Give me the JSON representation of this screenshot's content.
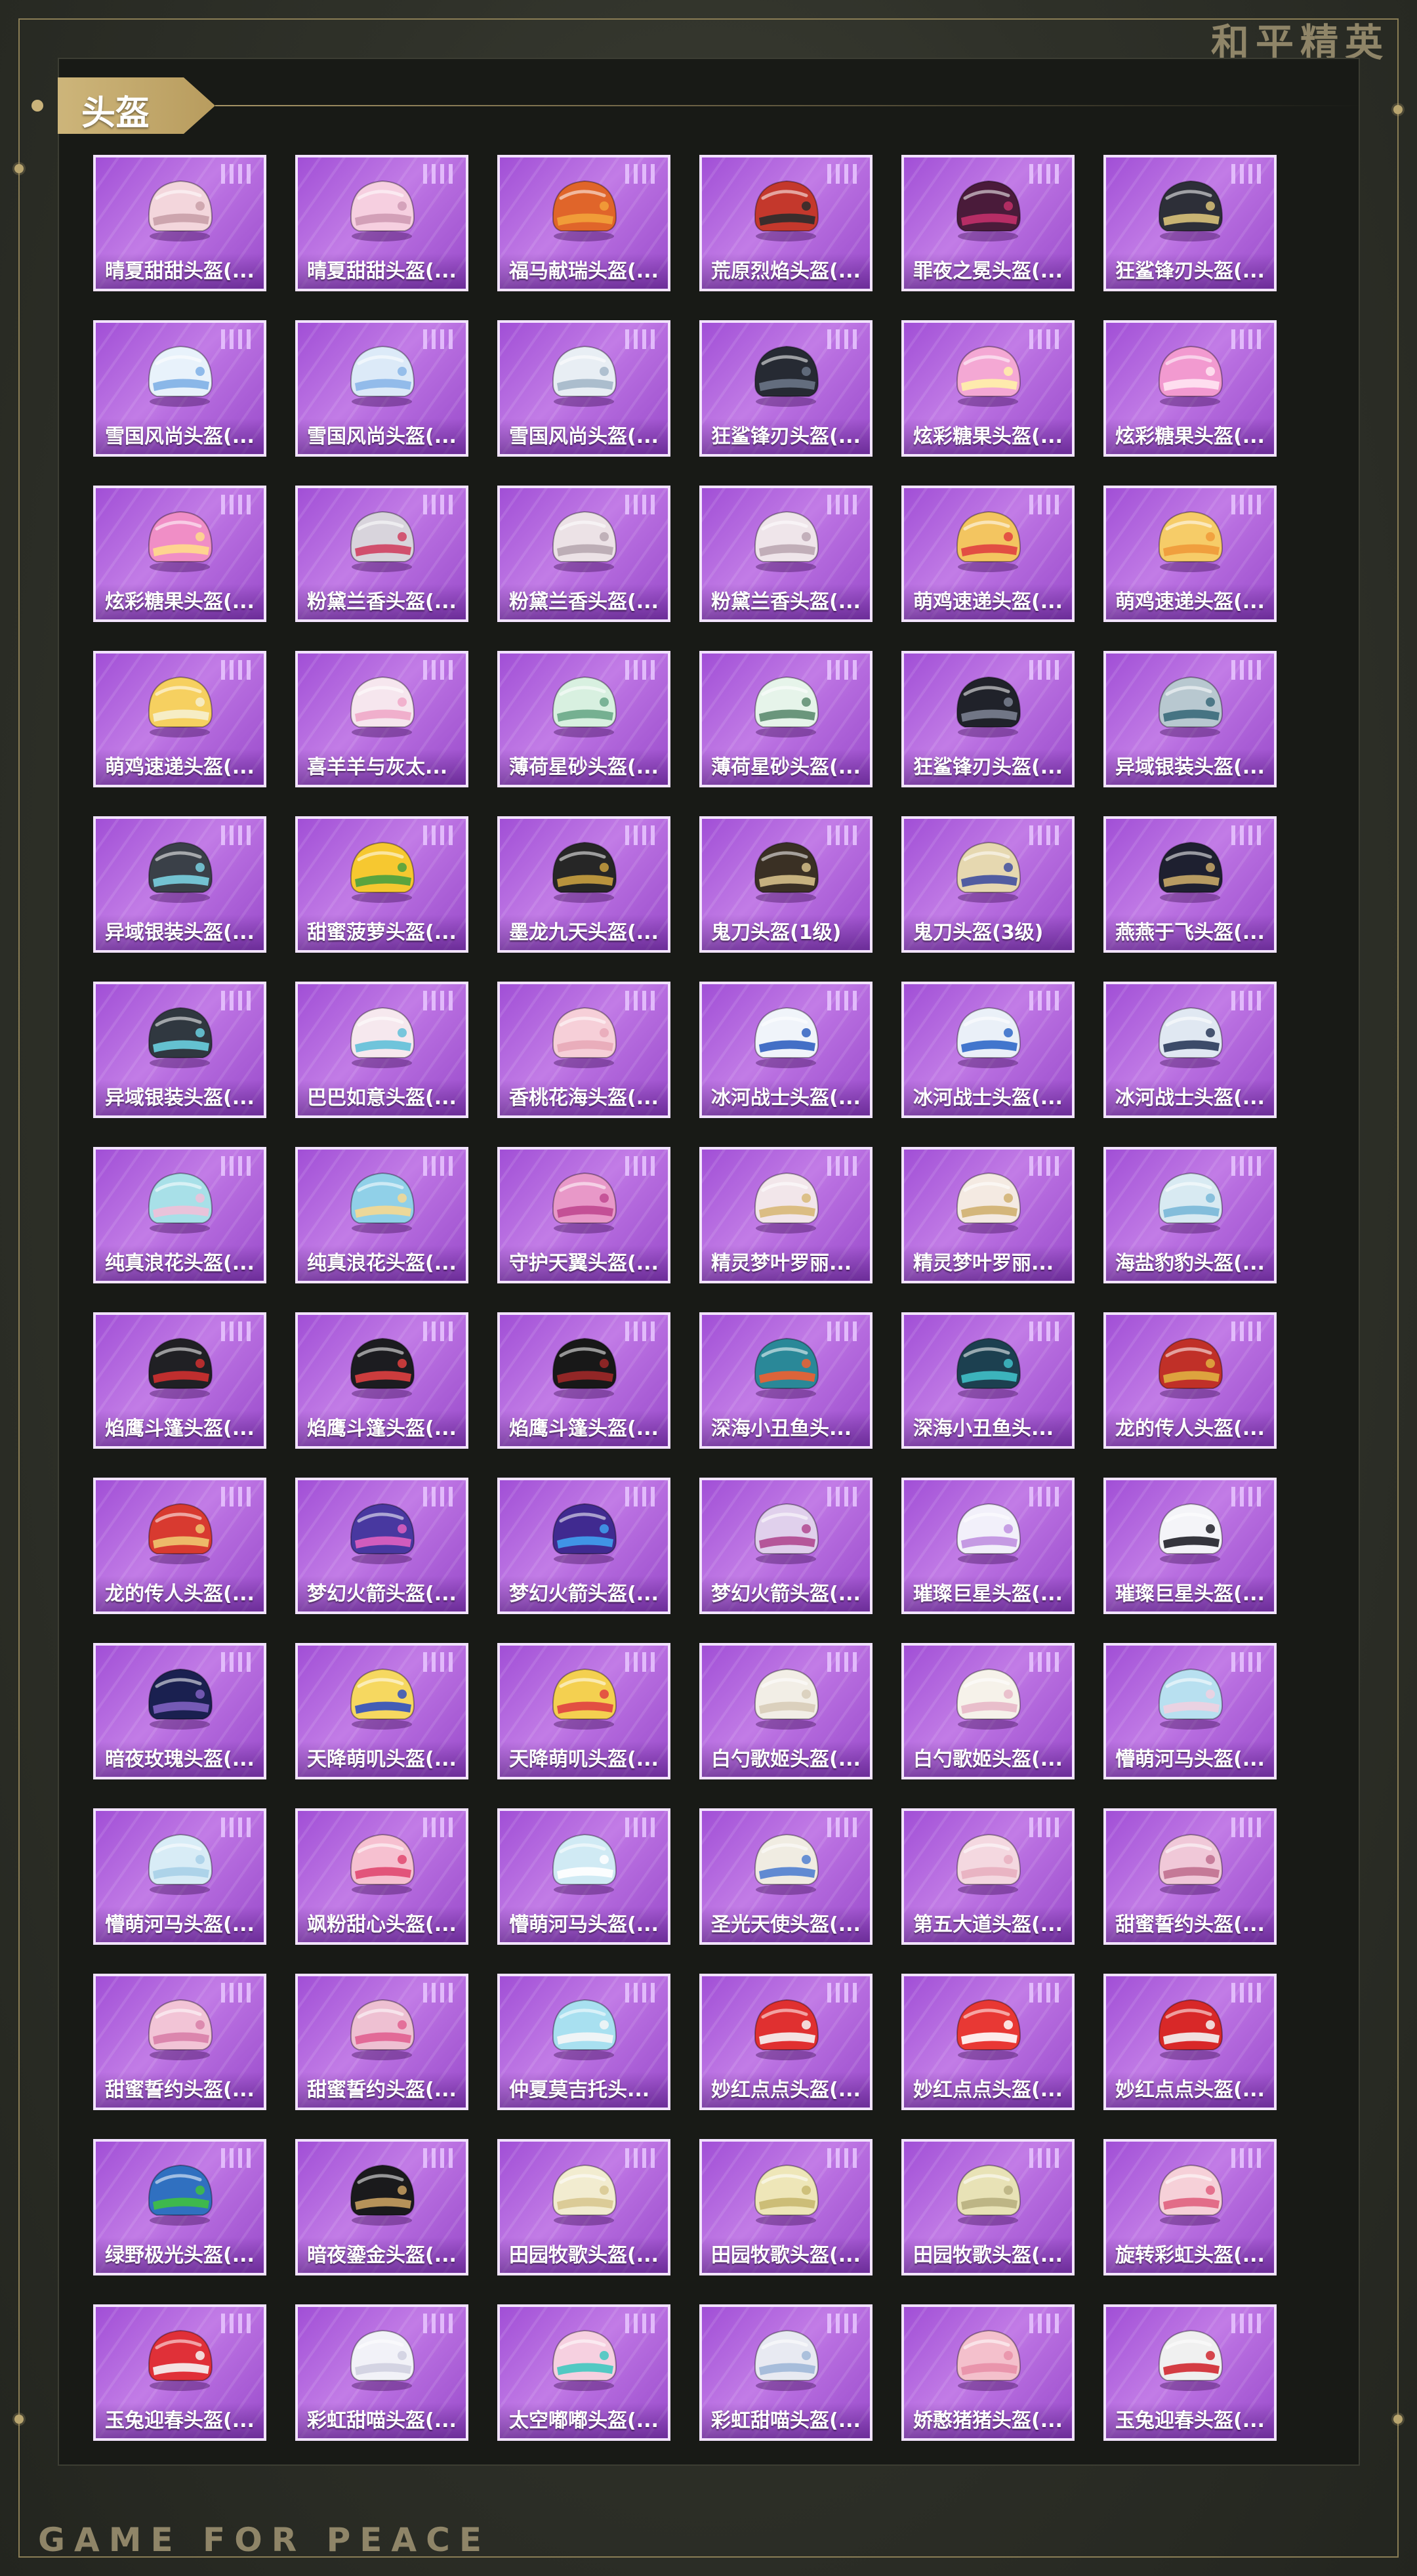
{
  "brand": "和平精英",
  "section": "头盔",
  "footer": "GAME FOR PEACE",
  "colors": {
    "card": "#b86ee0",
    "gold": "#cdb57a",
    "panel": "#181a16"
  },
  "items": [
    {
      "name": "晴夏甜甜头盔(...",
      "color": "#f3d6dc",
      "accent": "#c9a0a8"
    },
    {
      "name": "晴夏甜甜头盔(...",
      "color": "#f6cfe0",
      "accent": "#cf9ab4"
    },
    {
      "name": "福马献瑞头盔(...",
      "color": "#e0652a",
      "accent": "#f2a23a"
    },
    {
      "name": "荒原烈焰头盔(...",
      "color": "#c4382c",
      "accent": "#2c2c2c"
    },
    {
      "name": "罪夜之冕头盔(...",
      "color": "#4a1b3a",
      "accent": "#c2306a"
    },
    {
      "name": "狂鲨锋刃头盔(...",
      "color": "#2d2f38",
      "accent": "#d9c27a"
    },
    {
      "name": "雪国风尚头盔(...",
      "color": "#e8f2fb",
      "accent": "#7fb0e6"
    },
    {
      "name": "雪国风尚头盔(...",
      "color": "#dceaf8",
      "accent": "#8ab6e8"
    },
    {
      "name": "雪国风尚头盔(...",
      "color": "#e8eef4",
      "accent": "#a4b7c9"
    },
    {
      "name": "狂鲨锋刃头盔(...",
      "color": "#262a33",
      "accent": "#6a7486"
    },
    {
      "name": "炫彩糖果头盔(...",
      "color": "#f4a8d4",
      "accent": "#fff1a8"
    },
    {
      "name": "炫彩糖果头盔(...",
      "color": "#f29ad0",
      "accent": "#ffe6f2"
    },
    {
      "name": "炫彩糖果头盔(...",
      "color": "#f08ec6",
      "accent": "#ffdc8a"
    },
    {
      "name": "粉黛兰香头盔(...",
      "color": "#d8d4dc",
      "accent": "#d04060"
    },
    {
      "name": "粉黛兰香头盔(...",
      "color": "#ece2e6",
      "accent": "#b8a8b0"
    },
    {
      "name": "粉黛兰香头盔(...",
      "color": "#efe5ea",
      "accent": "#bba7b3"
    },
    {
      "name": "萌鸡速递头盔(...",
      "color": "#f3c560",
      "accent": "#e04040"
    },
    {
      "name": "萌鸡速递头盔(...",
      "color": "#f6cc68",
      "accent": "#f09a3a"
    },
    {
      "name": "萌鸡速递头盔(...",
      "color": "#f6d060",
      "accent": "#f6f0d0"
    },
    {
      "name": "喜羊羊与灰太...",
      "color": "#f6e6ee",
      "accent": "#f0a8c8"
    },
    {
      "name": "薄荷星砂头盔(...",
      "color": "#d8f0e0",
      "accent": "#6aa888"
    },
    {
      "name": "薄荷星砂头盔(...",
      "color": "#e6f4ea",
      "accent": "#5c8c70"
    },
    {
      "name": "狂鲨锋刃头盔(...",
      "color": "#20222a",
      "accent": "#7a8090"
    },
    {
      "name": "异域银装头盔(...",
      "color": "#b8c8d0",
      "accent": "#3a6a7a"
    },
    {
      "name": "异域银装头盔(...",
      "color": "#3a4048",
      "accent": "#7ad0e0"
    },
    {
      "name": "甜蜜菠萝头盔(...",
      "color": "#f6c830",
      "accent": "#4aa040"
    },
    {
      "name": "墨龙九天头盔(...",
      "color": "#262626",
      "accent": "#c9a040"
    },
    {
      "name": "鬼刀头盔(1级)",
      "color": "#3a3024",
      "accent": "#d6c08a"
    },
    {
      "name": "鬼刀头盔(3级)",
      "color": "#e6d8b0",
      "accent": "#4050a0"
    },
    {
      "name": "燕燕于飞头盔(...",
      "color": "#1e2030",
      "accent": "#c8a868"
    },
    {
      "name": "异域银装头盔(...",
      "color": "#303840",
      "accent": "#6ad0e0"
    },
    {
      "name": "巴巴如意头盔(...",
      "color": "#f6e8ee",
      "accent": "#60c0d8"
    },
    {
      "name": "香桃花海头盔(...",
      "color": "#f6cfd8",
      "accent": "#e8a8b8"
    },
    {
      "name": "冰河战士头盔(...",
      "color": "#f0f4fa",
      "accent": "#3060c0"
    },
    {
      "name": "冰河战士头盔(...",
      "color": "#eaf0f8",
      "accent": "#3068c8"
    },
    {
      "name": "冰河战士头盔(...",
      "color": "#e0e8f2",
      "accent": "#2a3a5a"
    },
    {
      "name": "纯真浪花头盔(...",
      "color": "#a8e0e8",
      "accent": "#f0c0d8"
    },
    {
      "name": "纯真浪花头盔(...",
      "color": "#90d0e8",
      "accent": "#f6d890"
    },
    {
      "name": "守护天翼头盔(...",
      "color": "#e898c8",
      "accent": "#c04890"
    },
    {
      "name": "精灵梦叶罗丽...",
      "color": "#f2e6ea",
      "accent": "#d8b878"
    },
    {
      "name": "精灵梦叶罗丽...",
      "color": "#f4eae2",
      "accent": "#d0b070"
    },
    {
      "name": "海盐豹豹头盔(...",
      "color": "#d8eaf2",
      "accent": "#7ab8d8"
    },
    {
      "name": "焰鹰斗篷头盔(...",
      "color": "#202024",
      "accent": "#d03030"
    },
    {
      "name": "焰鹰斗篷头盔(...",
      "color": "#1c1c20",
      "accent": "#e04040"
    },
    {
      "name": "焰鹰斗篷头盔(...",
      "color": "#181818",
      "accent": "#a02828"
    },
    {
      "name": "深海小丑鱼头...",
      "color": "#2a8898",
      "accent": "#f06030"
    },
    {
      "name": "深海小丑鱼头...",
      "color": "#1c4050",
      "accent": "#40c0c8"
    },
    {
      "name": "龙的传人头盔(...",
      "color": "#c03028",
      "accent": "#e0b040"
    },
    {
      "name": "龙的传人头盔(...",
      "color": "#d83a30",
      "accent": "#f0c870"
    },
    {
      "name": "梦幻火箭头盔(...",
      "color": "#4838a0",
      "accent": "#e060c0"
    },
    {
      "name": "梦幻火箭头盔(...",
      "color": "#402a90",
      "accent": "#40a0f0"
    },
    {
      "name": "梦幻火箭头盔(...",
      "color": "#e0d0ec",
      "accent": "#b04890"
    },
    {
      "name": "璀璨巨星头盔(...",
      "color": "#f2f0fa",
      "accent": "#c090e0"
    },
    {
      "name": "璀璨巨星头盔(...",
      "color": "#f4f4f8",
      "accent": "#202028"
    },
    {
      "name": "暗夜玫瑰头盔(...",
      "color": "#1a2050",
      "accent": "#8060c0"
    },
    {
      "name": "天降萌叽头盔(...",
      "color": "#f6d860",
      "accent": "#3050c0"
    },
    {
      "name": "天降萌叽头盔(...",
      "color": "#f4d050",
      "accent": "#e04040"
    },
    {
      "name": "白勺歌姬头盔(...",
      "color": "#f2eee6",
      "accent": "#d8ccb8"
    },
    {
      "name": "白勺歌姬头盔(...",
      "color": "#f6f2ea",
      "accent": "#e8b8c8"
    },
    {
      "name": "懵萌河马头盔(...",
      "color": "#b8e0f0",
      "accent": "#f0d0e0"
    },
    {
      "name": "懵萌河马头盔(...",
      "color": "#d8ecf6",
      "accent": "#a8d0e8"
    },
    {
      "name": "飒粉甜心头盔(...",
      "color": "#f6c0d0",
      "accent": "#e04870"
    },
    {
      "name": "懵萌河马头盔(...",
      "color": "#d0eaf4",
      "accent": "#ffffff"
    },
    {
      "name": "圣光天使头盔(...",
      "color": "#f0ece2",
      "accent": "#5080d0"
    },
    {
      "name": "第五大道头盔(...",
      "color": "#f4d8e0",
      "accent": "#e8b0c0"
    },
    {
      "name": "甜蜜誓约头盔(...",
      "color": "#f0c8d8",
      "accent": "#c07090"
    },
    {
      "name": "甜蜜誓约头盔(...",
      "color": "#f2c4d6",
      "accent": "#d880a8"
    },
    {
      "name": "甜蜜誓约头盔(...",
      "color": "#eec0d2",
      "accent": "#e06090"
    },
    {
      "name": "仲夏莫吉托头...",
      "color": "#a8e0f0",
      "accent": "#f6f6f6"
    },
    {
      "name": "妙红点点头盔(...",
      "color": "#e03030",
      "accent": "#f6f6f6"
    },
    {
      "name": "妙红点点头盔(...",
      "color": "#e83834",
      "accent": "#ffffff"
    },
    {
      "name": "妙红点点头盔(...",
      "color": "#d82828",
      "accent": "#f4f4f4"
    },
    {
      "name": "绿野极光头盔(...",
      "color": "#3070c0",
      "accent": "#40c040"
    },
    {
      "name": "暗夜鎏金头盔(...",
      "color": "#1a1a1c",
      "accent": "#c8a060"
    },
    {
      "name": "田园牧歌头盔(...",
      "color": "#f2ecd0",
      "accent": "#d8c890"
    },
    {
      "name": "田园牧歌头盔(...",
      "color": "#eee6b8",
      "accent": "#c8b870"
    },
    {
      "name": "田园牧歌头盔(...",
      "color": "#e8e2b6",
      "accent": "#b8b080"
    },
    {
      "name": "旋转彩虹头盔(...",
      "color": "#f6d0d8",
      "accent": "#e06080"
    },
    {
      "name": "玉兔迎春头盔(...",
      "color": "#e03038",
      "accent": "#f6f6f6"
    },
    {
      "name": "彩虹甜喵头盔(...",
      "color": "#f2f2f8",
      "accent": "#d0d0e0"
    },
    {
      "name": "太空嘟嘟头盔(...",
      "color": "#f6d0e0",
      "accent": "#40c8c0"
    },
    {
      "name": "彩虹甜喵头盔(...",
      "color": "#e8eaf2",
      "accent": "#a0b8d8"
    },
    {
      "name": "娇憨猪猪头盔(...",
      "color": "#f4c0cc",
      "accent": "#e890a8"
    },
    {
      "name": "玉兔迎春头盔(...",
      "color": "#f0f0f0",
      "accent": "#d02830"
    }
  ]
}
